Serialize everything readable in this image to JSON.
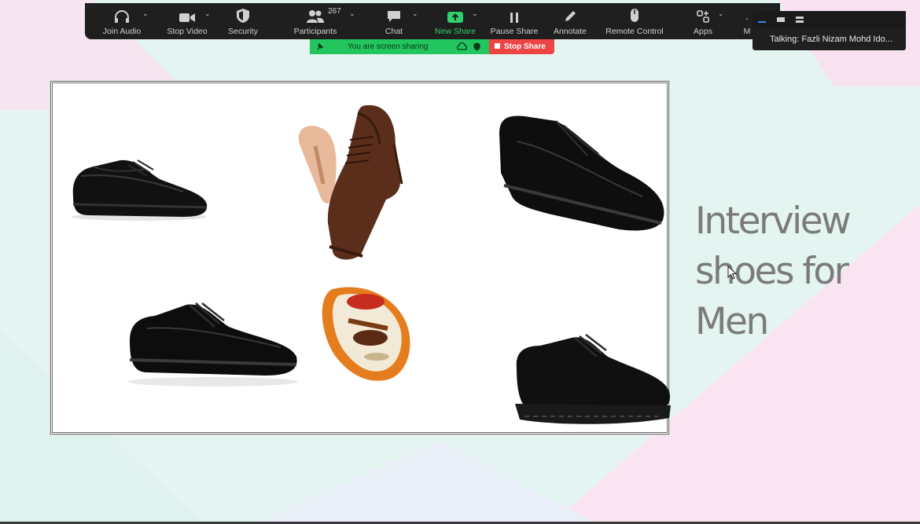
{
  "toolbar": {
    "join_audio": "Join Audio",
    "stop_video": "Stop Video",
    "security": "Security",
    "participants": "Participants",
    "participants_count": "267",
    "chat": "Chat",
    "new_share": "New Share",
    "pause_share": "Pause Share",
    "annotate": "Annotate",
    "remote_control": "Remote Control",
    "apps": "Apps",
    "more_truncated": "M"
  },
  "sharing": {
    "status_text": "You are screen sharing",
    "stop_label": "Stop Share"
  },
  "talking": "Talking: Fazli Nizam Mohd Ido...",
  "slide": {
    "heading_lines": [
      "Interview",
      "shoes for",
      "Men"
    ]
  },
  "colors": {
    "toolbar_bg": "#1f1f1f",
    "share_green": "#22c55e",
    "stop_red": "#ef4444",
    "heading_gray": "#7b7b7b"
  },
  "icons": [
    "headphones-icon",
    "video-camera-icon",
    "shield-icon",
    "participants-icon",
    "chat-bubble-icon",
    "share-arrow-icon",
    "pause-icon",
    "pencil-icon",
    "mouse-icon",
    "apps-icon"
  ]
}
